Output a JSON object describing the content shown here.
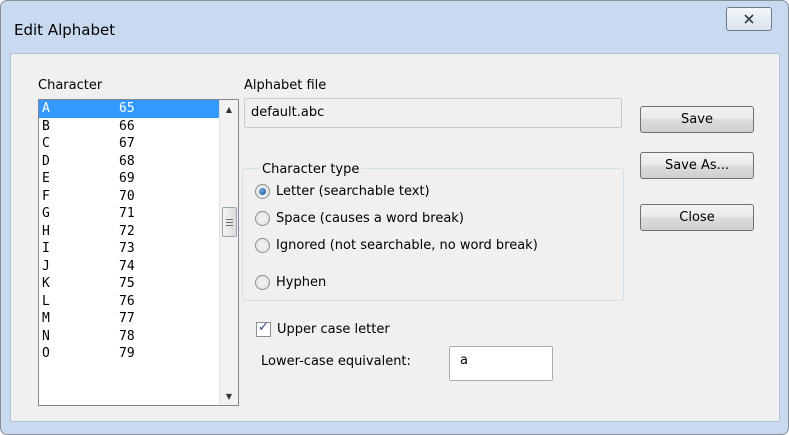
{
  "window": {
    "title": "Edit Alphabet",
    "close_icon": "close-icon"
  },
  "character": {
    "label": "Character",
    "items": [
      {
        "char": "A",
        "code": "65",
        "selected": true
      },
      {
        "char": "B",
        "code": "66"
      },
      {
        "char": "C",
        "code": "67"
      },
      {
        "char": "D",
        "code": "68"
      },
      {
        "char": "E",
        "code": "69"
      },
      {
        "char": "F",
        "code": "70"
      },
      {
        "char": "G",
        "code": "71"
      },
      {
        "char": "H",
        "code": "72"
      },
      {
        "char": "I",
        "code": "73"
      },
      {
        "char": "J",
        "code": "74"
      },
      {
        "char": "K",
        "code": "75"
      },
      {
        "char": "L",
        "code": "76"
      },
      {
        "char": "M",
        "code": "77"
      },
      {
        "char": "N",
        "code": "78"
      },
      {
        "char": "O",
        "code": "79"
      }
    ]
  },
  "alphabet_file": {
    "label": "Alphabet file",
    "value": "default.abc"
  },
  "character_type": {
    "label": "Character type",
    "options": [
      {
        "label": "Letter (searchable text)",
        "checked": true
      },
      {
        "label": "Space (causes a word break)",
        "checked": false
      },
      {
        "label": "Ignored (not searchable, no word break)",
        "checked": false
      },
      {
        "label": "Hyphen",
        "checked": false
      }
    ]
  },
  "upper_case": {
    "label": "Upper case letter",
    "checked": true
  },
  "lower_case": {
    "label": "Lower-case equivalent:",
    "value": "a"
  },
  "buttons": {
    "save": "Save",
    "save_as": "Save As...",
    "close": "Close"
  },
  "colors": {
    "selection": "#3399ff",
    "frame": "#c9daf0",
    "dialog": "#f0f0f0"
  }
}
